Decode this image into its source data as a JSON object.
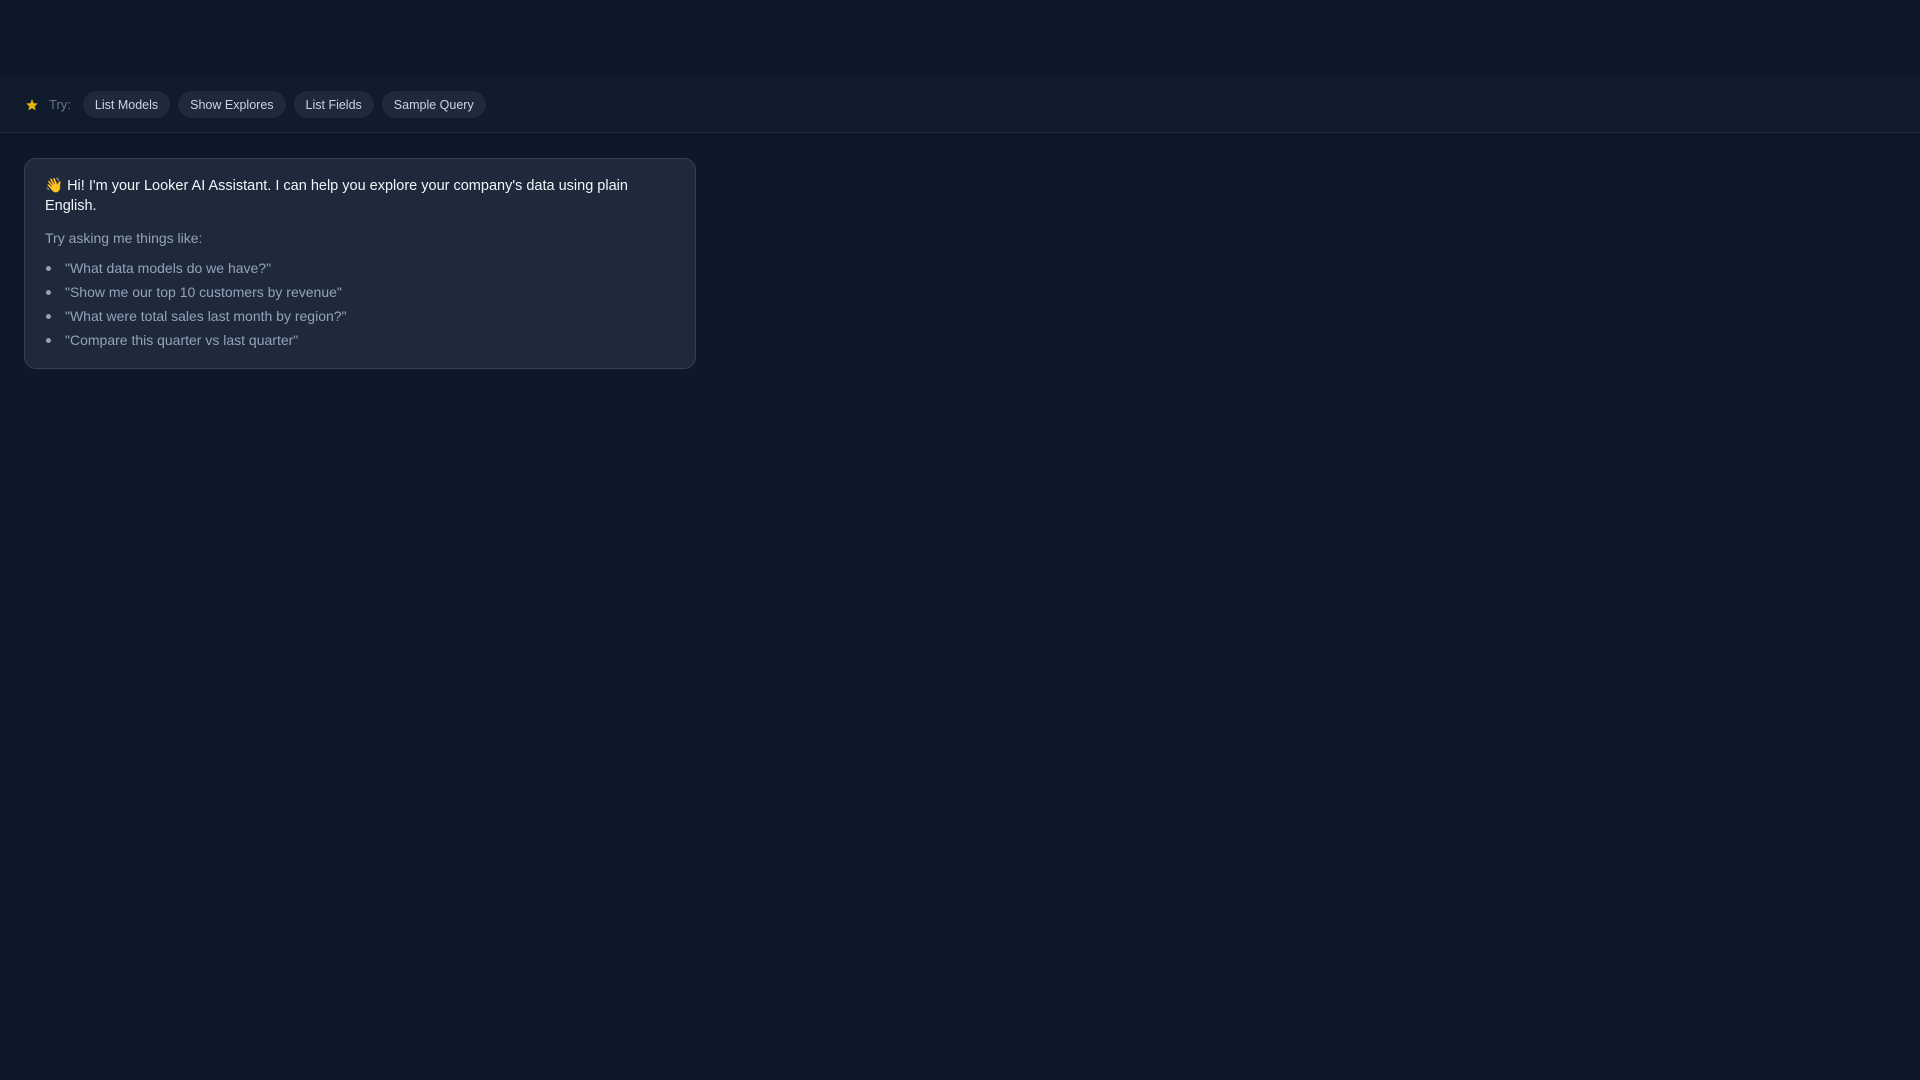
{
  "quick_bar": {
    "try_label": "Try:",
    "chips": [
      {
        "label": "List Models"
      },
      {
        "label": "Show Explores"
      },
      {
        "label": "List Fields"
      },
      {
        "label": "Sample Query"
      }
    ],
    "star_color": "#eab308"
  },
  "assistant_message": {
    "greeting": "👋 Hi! I'm your Looker AI Assistant. I can help you explore your company's data using plain English.",
    "prompt_intro": "Try asking me things like:",
    "suggestions": [
      "\"What data models do we have?\"",
      "\"Show me our top 10 customers by revenue\"",
      "\"What were total sales last month by region?\"",
      "\"Compare this quarter vs last quarter\""
    ]
  }
}
